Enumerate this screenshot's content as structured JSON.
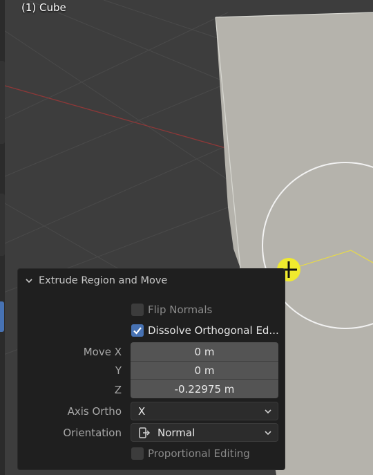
{
  "viewport": {
    "object_label": "(1) Cube",
    "colors": {
      "background": "#3d3d3d",
      "grid": "#4a4a4a",
      "x_axis": "#9a3a3a",
      "face": "#b5b3ac",
      "highlight": "#e6e04a"
    }
  },
  "panel": {
    "title": "Extrude Region and Move",
    "flip_normals": {
      "label": "Flip Normals",
      "checked": false
    },
    "dissolve_orthogonal": {
      "label": "Dissolve Orthogonal Ed...",
      "checked": true
    },
    "move": {
      "label": "Move X",
      "x": "0 m",
      "y_label": "Y",
      "y": "0 m",
      "z_label": "Z",
      "z": "-0.22975 m"
    },
    "axis_ortho": {
      "label": "Axis Ortho",
      "value": "X"
    },
    "orientation": {
      "label": "Orientation",
      "value": "Normal",
      "icon": "orientation-icon"
    },
    "proportional_editing": {
      "label": "Proportional Editing",
      "checked": false
    }
  }
}
